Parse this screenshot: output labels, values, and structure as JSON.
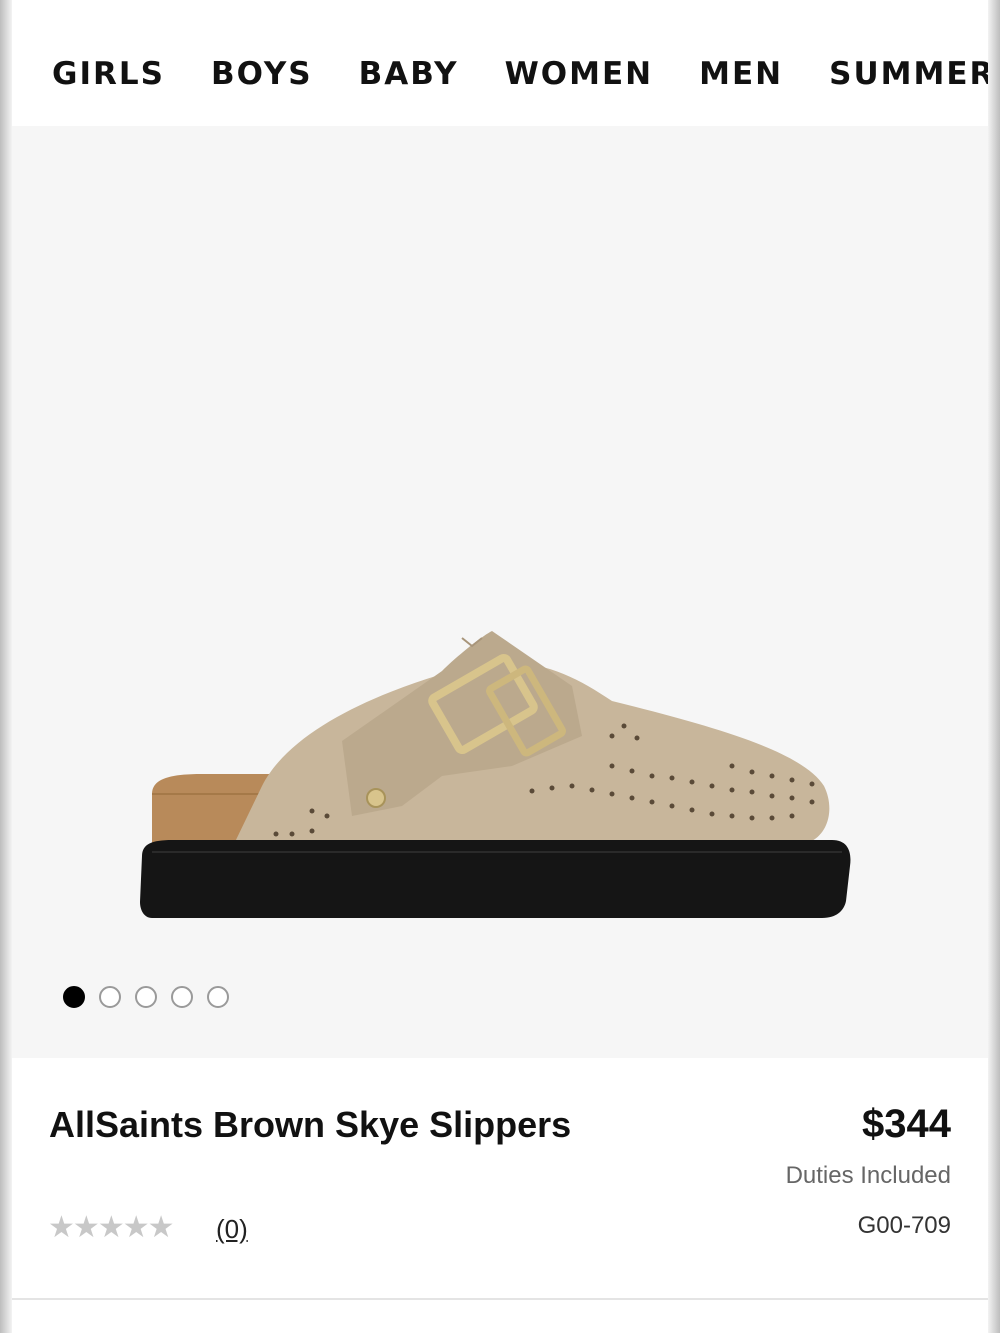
{
  "nav": {
    "items": [
      {
        "label": "GIRLS"
      },
      {
        "label": "BOYS"
      },
      {
        "label": "BABY"
      },
      {
        "label": "WOMEN"
      },
      {
        "label": "MEN"
      },
      {
        "label": "SUMMER S"
      }
    ]
  },
  "gallery": {
    "image_count": 5,
    "active_index": 0
  },
  "product": {
    "name": "AllSaints Brown Skye Slippers",
    "price": "$344",
    "duties": "Duties Included",
    "sku": "G00-709",
    "rating": 0,
    "rating_max": 5,
    "review_count": "(0)"
  },
  "colors": {
    "gallery_bg": "#f6f6f6",
    "suede": "#c8b69b",
    "sole": "#151515",
    "cork": "#b88a5a",
    "buckle": "#d8c48c",
    "star_inactive": "#c8c8c8"
  }
}
